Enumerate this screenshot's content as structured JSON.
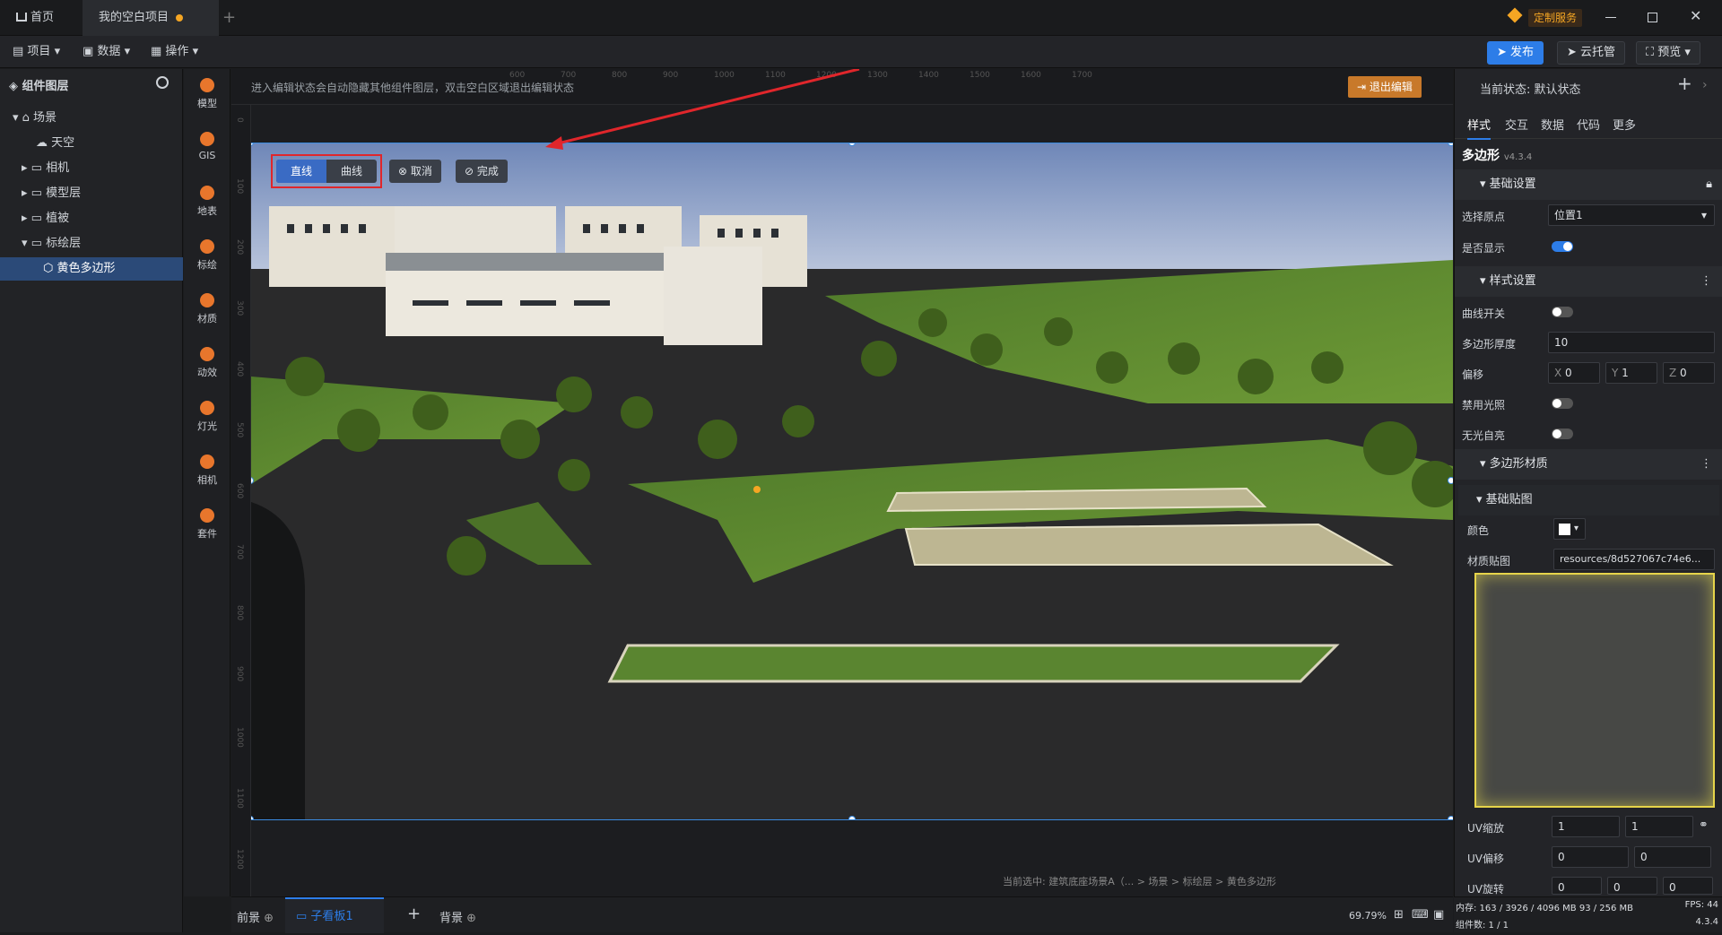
{
  "titlebar": {
    "tabs": [
      {
        "label": "首页"
      },
      {
        "label": "我的空白项目"
      }
    ],
    "custom_service": "定制服务",
    "window_icons": [
      "minimize-icon",
      "restore-icon",
      "close-icon"
    ]
  },
  "menubar": {
    "menus": [
      {
        "label": "项目"
      },
      {
        "label": "数据"
      },
      {
        "label": "操作"
      }
    ],
    "publish": "发布",
    "cloud": "云托管",
    "preview": "预览"
  },
  "left_panel": {
    "title": "组件图层",
    "tree": [
      {
        "label": "场景"
      },
      {
        "label": "天空"
      },
      {
        "label": "相机"
      },
      {
        "label": "模型层"
      },
      {
        "label": "植被"
      },
      {
        "label": "标绘层"
      },
      {
        "label": "黄色多边形"
      }
    ]
  },
  "tools": [
    {
      "label": "模型"
    },
    {
      "label": "GIS"
    },
    {
      "label": "地表"
    },
    {
      "label": "标绘"
    },
    {
      "label": "材质"
    },
    {
      "label": "动效"
    },
    {
      "label": "灯光"
    },
    {
      "label": "相机"
    },
    {
      "label": "套件"
    }
  ],
  "canvas": {
    "hint": "进入编辑状态会自动隐藏其他组件图层，双击空白区域退出编辑状态",
    "exit_edit": "退出编辑",
    "line_btn": "直线",
    "curve_btn": "曲线",
    "cancel_btn": "取消",
    "done_btn": "完成",
    "selection": "当前选中: 建筑底座场景A（... > 场景 > 标绘层 > 黄色多边形",
    "ruler_top": [
      "600",
      "700",
      "800",
      "900",
      "1000",
      "1100",
      "1200",
      "1300",
      "1400",
      "1500",
      "1600",
      "1700"
    ],
    "ruler_left": [
      "0",
      "100",
      "200",
      "300",
      "400",
      "500",
      "600",
      "700",
      "800",
      "900",
      "1000",
      "1100",
      "1200"
    ]
  },
  "right_panel": {
    "state": "当前状态: 默认状态",
    "tabs": [
      {
        "label": "样式"
      },
      {
        "label": "交互"
      },
      {
        "label": "数据"
      },
      {
        "label": "代码"
      },
      {
        "label": "更多"
      }
    ],
    "component": "多边形",
    "version": "v4.3.4",
    "sections": {
      "basic": "基础设置",
      "style": "样式设置",
      "material": "多边形材质",
      "basic_map": "基础贴图"
    },
    "props": {
      "origin_label": "选择原点",
      "origin_value": "位置1",
      "visible_label": "是否显示",
      "curve_label": "曲线开关",
      "thickness_label": "多边形厚度",
      "thickness_value": "10",
      "offset_label": "偏移",
      "offset_x": "0",
      "offset_y": "1",
      "offset_z": "0",
      "disable_light_label": "禁用光照",
      "no_light_label": "无光自亮",
      "color_label": "颜色",
      "texture_label": "材质贴图",
      "texture_value": "resources/8d527067c74e6...",
      "uv_scale_label": "UV缩放",
      "uv_scale_x": "1",
      "uv_scale_y": "1",
      "uv_offset_label": "UV偏移",
      "uv_offset_x": "0",
      "uv_offset_y": "0",
      "uv_rotate_label": "UV旋转",
      "uv_rotate_a": "0",
      "uv_rotate_b": "0",
      "uv_rotate_c": "0"
    }
  },
  "bottom": {
    "front": "前景",
    "board": "子看板1",
    "back": "背景",
    "zoom": "69.79%",
    "memory": "内存: 163 / 3926 / 4096 MB  93 / 256 MB",
    "fps": "FPS: 44",
    "count": "组件数: 1 / 1",
    "version": "4.3.4"
  },
  "colors": {
    "accent": "#2d7de8",
    "orange": "#f5a623",
    "highlight_red": "#e0262b"
  }
}
